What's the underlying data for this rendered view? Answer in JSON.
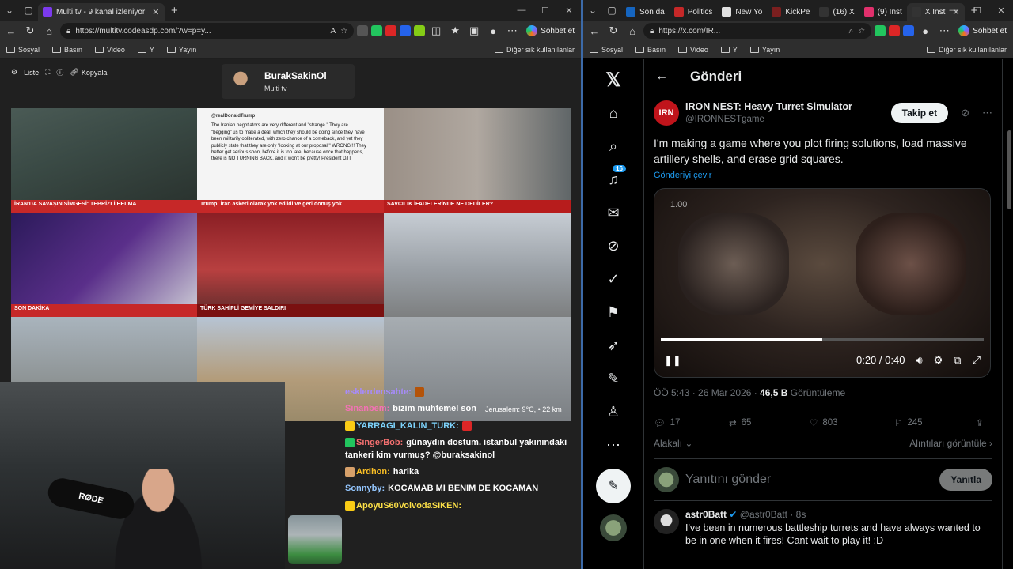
{
  "left_window": {
    "tabs": [
      {
        "label": "Multi tv - 9 kanal izleniyor"
      }
    ],
    "url": "https://multitv.codeasdp.com/?w=p=y...",
    "copilot_label": "Sohbet et",
    "bookmarks": [
      "Sosyal",
      "Basın",
      "Video",
      "Y",
      "Yayın"
    ],
    "bookmarks_other": "Diğer sık kullanılanlar",
    "toolbar": {
      "list_label": "Liste",
      "copy_label": "Kopyala"
    },
    "channel": {
      "name": "BurakSakinOl",
      "sub": "Multi tv"
    },
    "cells": [
      {
        "strip": "İRAN'DA SAVAŞIN SİMGESİ: TEBRİZLİ HELMA",
        "strip_color": "#c62828"
      },
      {
        "tweet_user": "@realDonaldTrump",
        "tweet_text": "The Iranian negotiators are very different and \"strange.\" They are \"begging\" us to make a deal, which they should be doing since they have been militarily obliterated, with zero chance of a comeback, and yet they publicly state that they are only \"looking at our proposal.\" WRONG!!! They better get serious soon, before it is too late, because once that happens, there is NO TURNING BACK, and it won't be pretty! President DJT",
        "strip": "Trump: İran askeri olarak yok edildi ve geri dönüş yok",
        "strip_color": "#c62828"
      },
      {
        "strip": "SAVCILIK İFADELERİNDE NE DEDİLER?",
        "strip_color": "#b71c1c"
      },
      {
        "strip": "SON DAKİKA",
        "strip_color": "#c62828"
      },
      {
        "strip": "TÜRK SAHİPLİ GEMİYE SALDIRI",
        "strip_color": "#7a1010"
      },
      {
        "strip": "",
        "strip_color": "transparent"
      },
      {
        "strip": "",
        "strip_color": "transparent"
      },
      {
        "strip": "",
        "strip_color": "transparent"
      },
      {
        "strip": "Jerusalem: 9°C, • 22 km",
        "strip_color": "transparent"
      }
    ],
    "webcam_mic_label": "RØDE",
    "chat": [
      {
        "user": "esklerdensahte:",
        "user_color": "#a78bfa",
        "text": ""
      },
      {
        "user": "Sinanbem:",
        "user_color": "#f472b6",
        "text": "bizim muhtemel son"
      },
      {
        "user": "YARRAGI_KALIN_TURK:",
        "user_color": "#7dd3fc",
        "text": ""
      },
      {
        "user": "SingerBob:",
        "user_color": "#f87171",
        "text": "günaydın dostum. istanbul yakınındaki tankeri kim vurmuş? @buraksakinol"
      },
      {
        "user": "Ardhon:",
        "user_color": "#fbbf24",
        "text": "harika"
      },
      {
        "user": "Sonnyby:",
        "user_color": "#93c5fd",
        "text": "KOCAMAB MI BENIM DE KOCAMAN"
      },
      {
        "user": "ApoyuS60VolvodaSIKEN:",
        "user_color": "#fde047",
        "text": ""
      }
    ]
  },
  "right_window": {
    "tabs": [
      {
        "label": "Son da",
        "color": "#1565c0"
      },
      {
        "label": "Politics",
        "color": "#c62828"
      },
      {
        "label": "New Yo",
        "color": "#e0e0e0"
      },
      {
        "label": "KickPe",
        "color": "#7b1f1f"
      },
      {
        "label": "(16) X",
        "color": "#000000"
      },
      {
        "label": "(9) Inst",
        "color": "#e1306c"
      },
      {
        "label": "X Inst",
        "color": "#000000"
      }
    ],
    "url": "https://x.com/IR...",
    "copilot_label": "Sohbet et",
    "bookmarks": [
      "Sosyal",
      "Basın",
      "Video",
      "Y",
      "Yayın"
    ],
    "bookmarks_other": "Diğer sık kullanılanlar",
    "notif_count": "16",
    "header_title": "Gönderi",
    "tweet": {
      "avatar_text": "IRN",
      "name": "IRON NEST: Heavy Turret Simulator",
      "handle": "@IRONNESTgame",
      "follow_label": "Takip et",
      "text": "I'm making a game where you plot firing solutions, load massive artillery shells, and erase grid squares.",
      "translate": "Gönderiyi çevir",
      "speed": "1.00",
      "time": "0:20 / 0:40",
      "progress": 0.5,
      "date": "ÖÖ 5:43 · 26 Mar 2026 ·",
      "views": "46,5 B",
      "views_label": "Görüntüleme",
      "replies": "17",
      "retweets": "65",
      "likes": "803",
      "bookmarks": "245"
    },
    "sort_label": "Alakalı",
    "quotes_label": "Alıntıları görüntüle",
    "reply_placeholder": "Yanıtını gönder",
    "reply_button": "Yanıtla",
    "reply": {
      "name": "astr0Batt",
      "handle": "@astr0Batt · 8s",
      "text": "I've been in numerous battleship turrets and have always wanted to be in one when it fires! Cant wait to play it! :D"
    }
  }
}
